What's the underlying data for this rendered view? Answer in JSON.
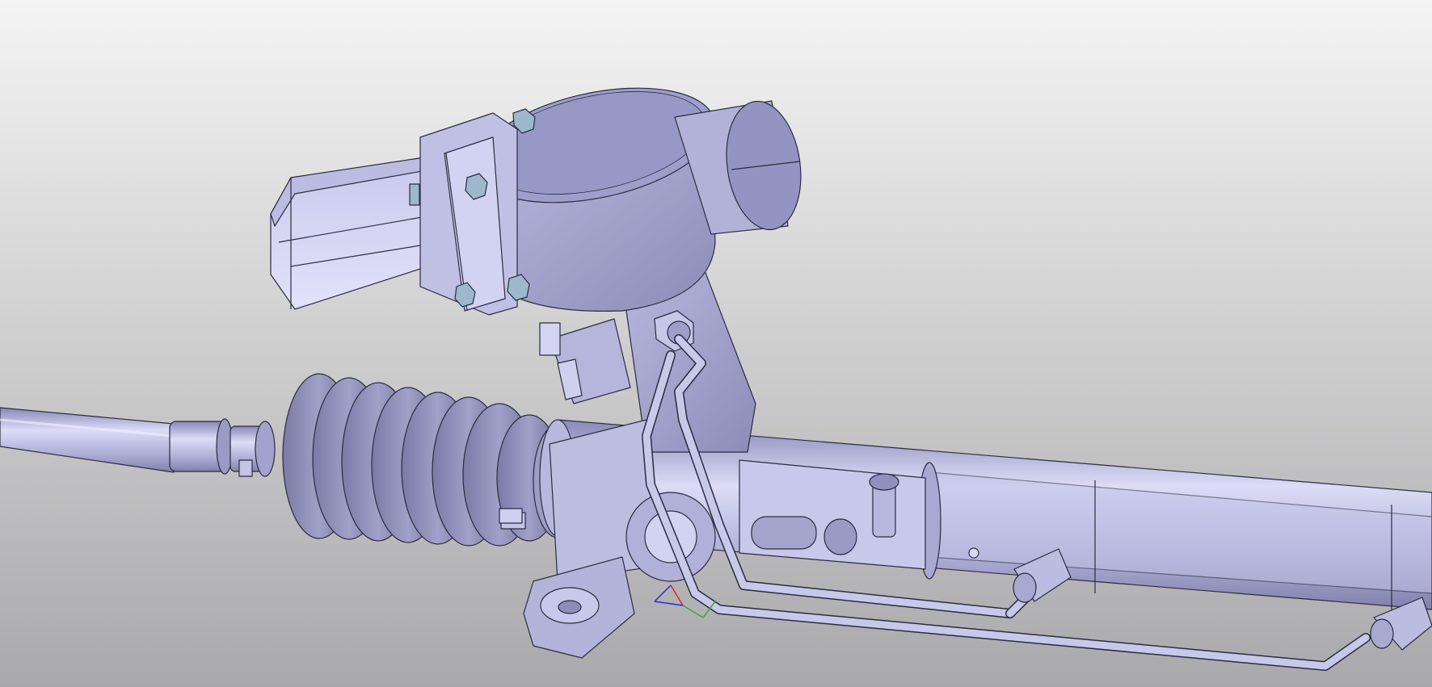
{
  "viewport": {
    "background_top": "#f4f4f4",
    "background_bottom": "#a9a9ab"
  },
  "model": {
    "body_color": "#b3b3d9",
    "body_light": "#d6d6f5",
    "body_dark": "#8a8ab8",
    "edge_color": "#2b2b40",
    "bolt_color": "#9db8cc"
  },
  "axis_triad": {
    "x_color": "#e02020",
    "y_color": "#30b030",
    "z_color": "#2a2adc"
  }
}
